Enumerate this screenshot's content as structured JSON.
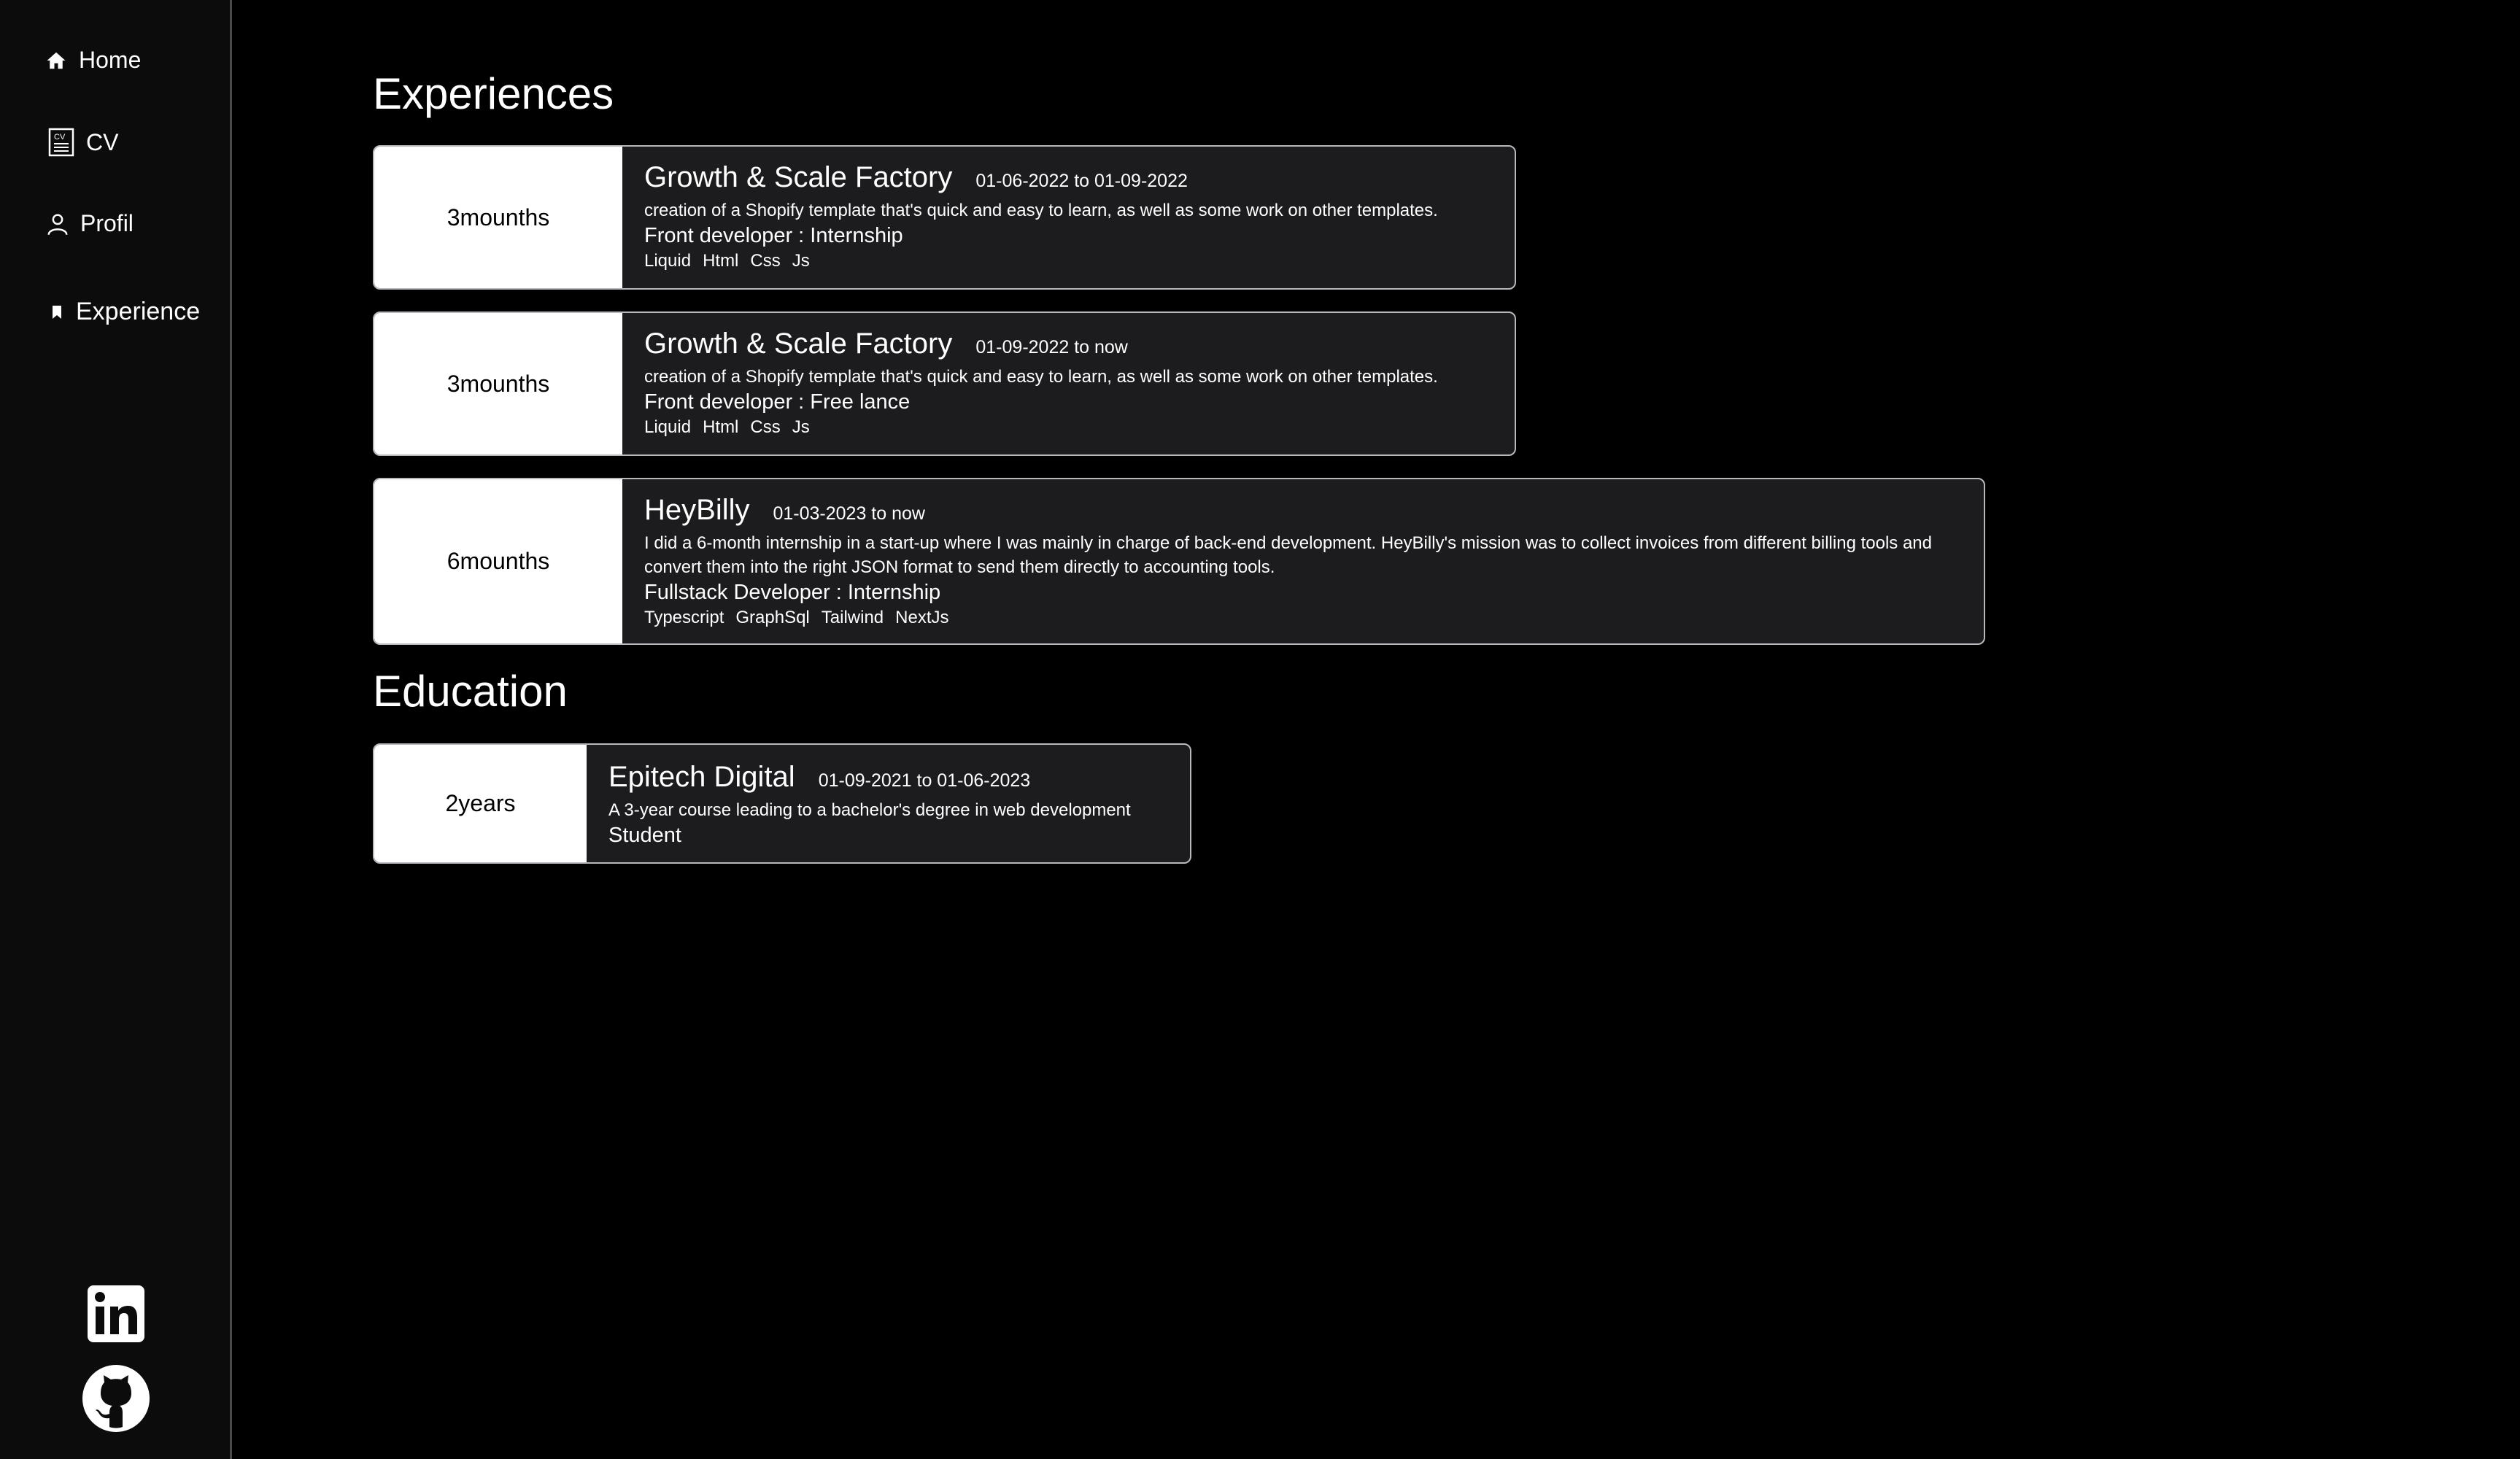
{
  "sidebar": {
    "items": [
      {
        "label": "Home",
        "icon": "home-icon"
      },
      {
        "label": "CV",
        "icon": "cv-icon"
      },
      {
        "label": "Profil",
        "icon": "user-icon"
      },
      {
        "label": "Experience",
        "icon": "bookmark-icon"
      }
    ],
    "social": [
      {
        "icon": "linkedin-icon"
      },
      {
        "icon": "github-icon"
      }
    ]
  },
  "experiences": {
    "title": "Experiences",
    "items": [
      {
        "duration": "3mounths",
        "company": "Growth & Scale Factory",
        "dates": "01-06-2022 to 01-09-2022",
        "description": "creation of a Shopify template that's quick and easy to learn, as well as some work on other templates.",
        "role": "Front developer : Internship",
        "tags": [
          "Liquid",
          "Html",
          "Css",
          "Js"
        ]
      },
      {
        "duration": "3mounths",
        "company": "Growth & Scale Factory",
        "dates": "01-09-2022 to now",
        "description": "creation of a Shopify template that's quick and easy to learn, as well as some work on other templates.",
        "role": "Front developer : Free lance",
        "tags": [
          "Liquid",
          "Html",
          "Css",
          "Js"
        ]
      },
      {
        "duration": "6mounths",
        "company": "HeyBilly",
        "dates": "01-03-2023 to now",
        "description": "I did a 6-month internship in a start-up where I was mainly in charge of back-end development. HeyBilly's mission was to collect invoices from different billing tools and convert them into the right JSON format to send them directly to accounting tools.",
        "role": "Fullstack Developer : Internship",
        "tags": [
          "Typescript",
          "GraphSql",
          "Tailwind",
          "NextJs"
        ]
      }
    ]
  },
  "education": {
    "title": "Education",
    "items": [
      {
        "duration": "2years",
        "school": "Epitech Digital",
        "dates": "01-09-2021 to 01-06-2023",
        "description": "A 3-year course leading to a bachelor's degree in web development",
        "role": "Student"
      }
    ]
  },
  "colors": {
    "background": "#000000",
    "sidebar": "#0c0c0d",
    "card": "#1c1c1e",
    "card_border": "#b9b9bd",
    "duration_bg": "#ffffff"
  }
}
